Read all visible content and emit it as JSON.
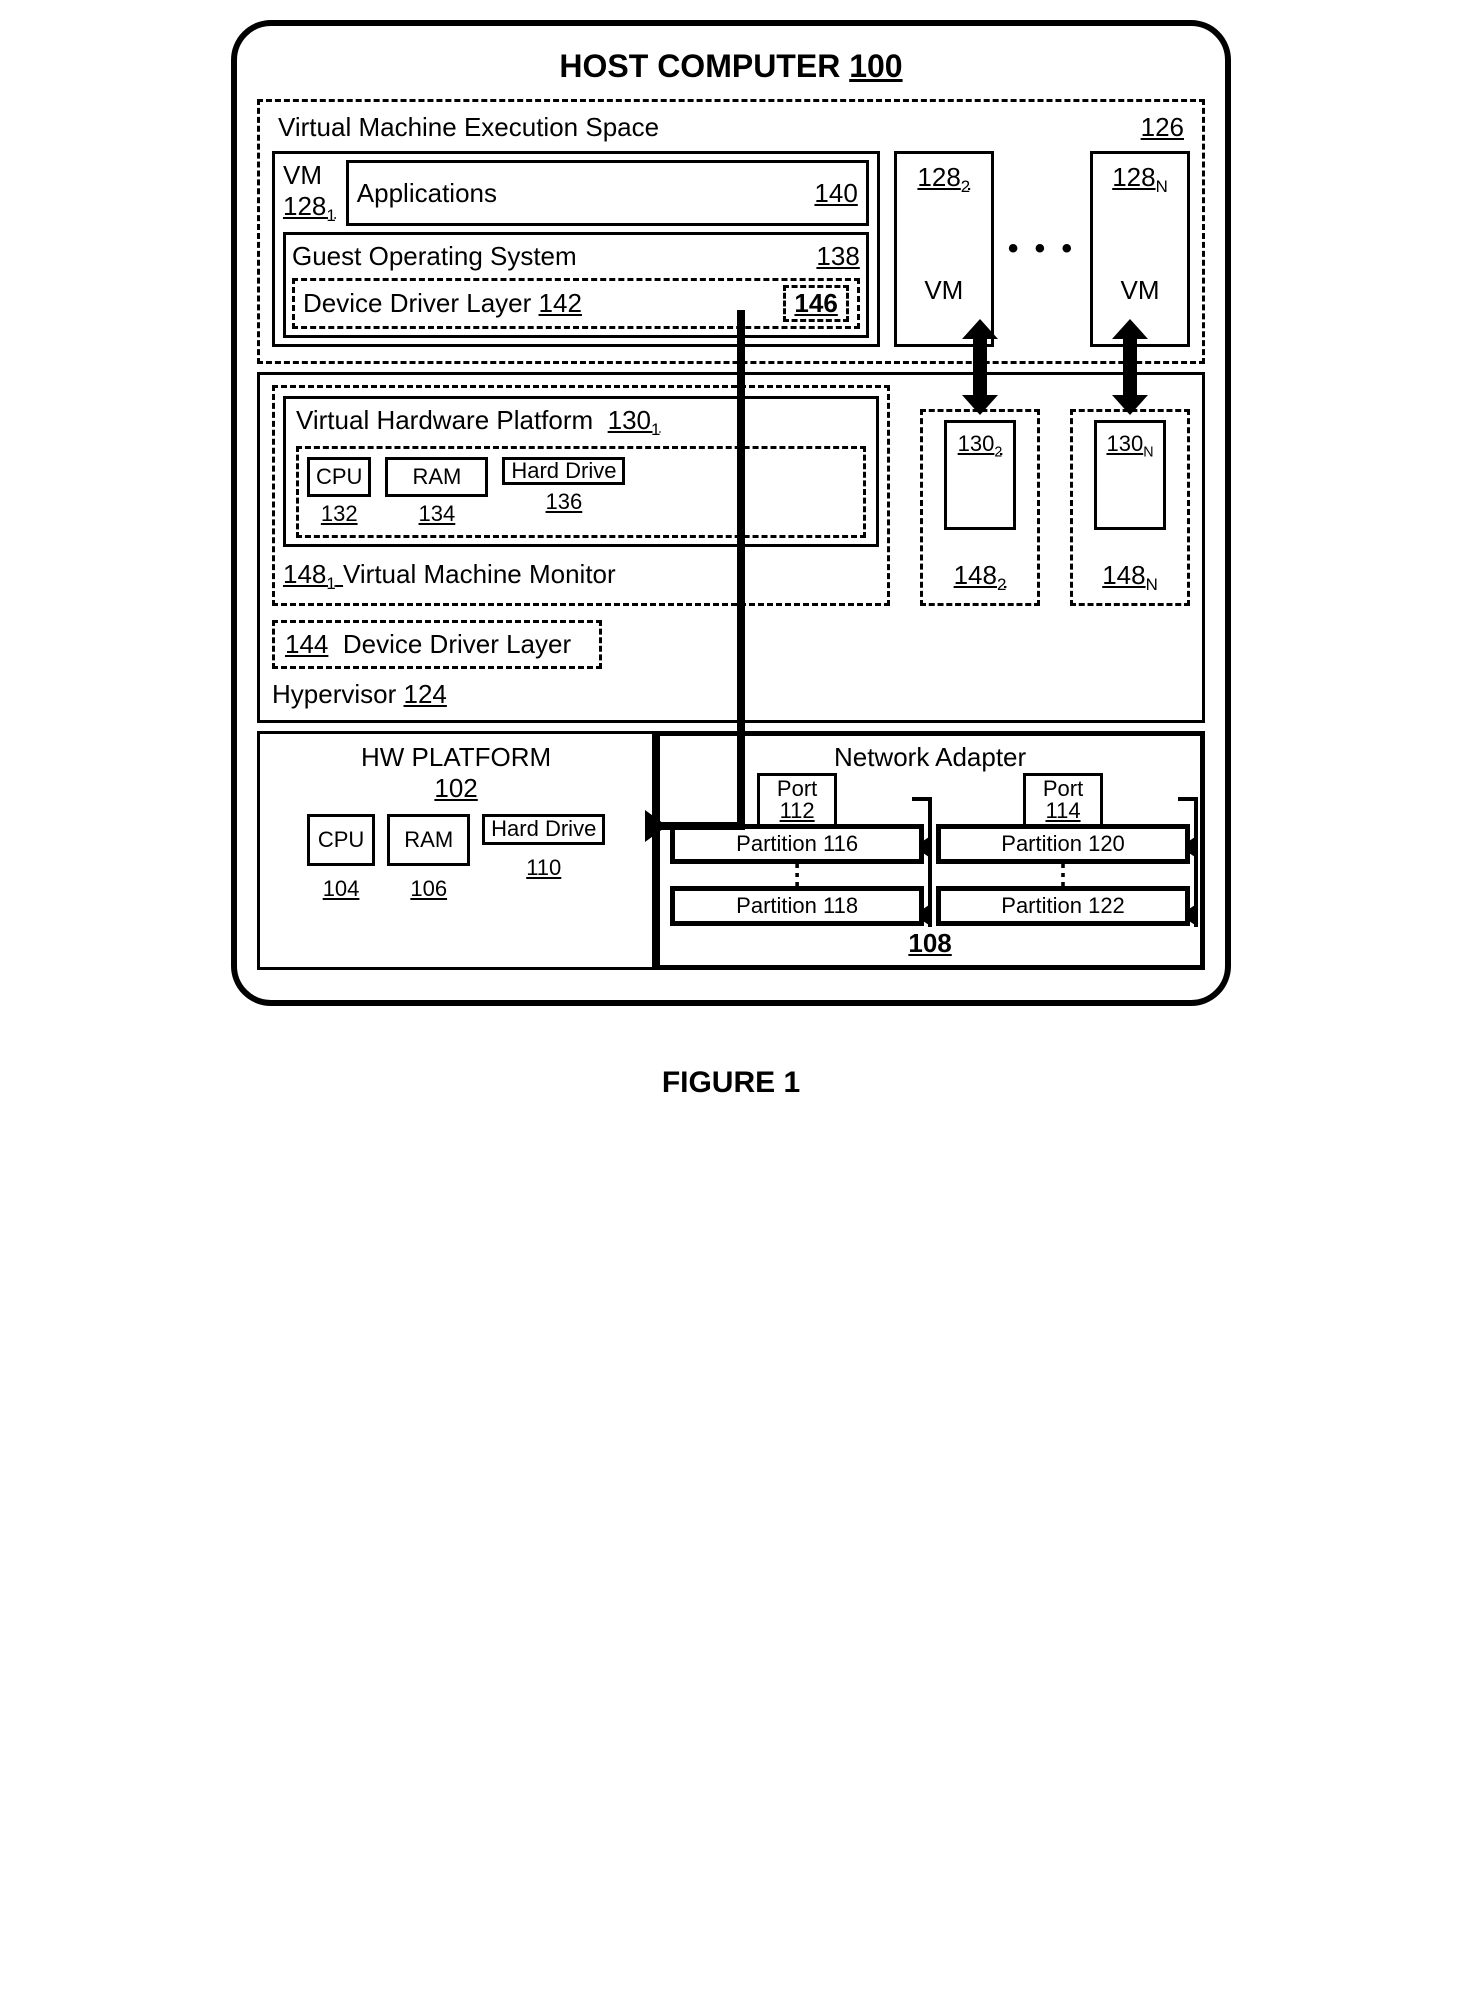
{
  "title": {
    "text": "HOST COMPUTER",
    "ref": "100"
  },
  "figure_caption": "FIGURE 1",
  "exec_space": {
    "label": "Virtual Machine Execution Space",
    "ref": "126",
    "vm1": {
      "label": "VM",
      "ref": "128",
      "sub": "1",
      "apps_label": "Applications",
      "apps_ref": "140",
      "gos_label": "Guest Operating System",
      "gos_ref": "138",
      "ddl_label": "Device Driver Layer",
      "ddl_ref": "142",
      "ddl_item_ref": "146"
    },
    "vm2": {
      "ref": "128",
      "sub": "2",
      "label": "VM"
    },
    "vmN": {
      "ref": "128",
      "sub": "N",
      "label": "VM"
    }
  },
  "hypervisor": {
    "label": "Hypervisor",
    "ref": "124",
    "ddl_label": "Device Driver Layer",
    "ddl_ref": "144",
    "vmm1": {
      "ref": "148",
      "sub": "1",
      "label": "Virtual Machine Monitor",
      "vhp_label": "Virtual Hardware Platform",
      "vhp_ref": "130",
      "vhp_sub": "1",
      "cpu": "CPU",
      "cpu_ref": "132",
      "ram": "RAM",
      "ram_ref": "134",
      "hd": "Hard Drive",
      "hd_ref": "136"
    },
    "vmm2": {
      "ref": "148",
      "sub": "2",
      "vhp_ref": "130",
      "vhp_sub": "2"
    },
    "vmmN": {
      "ref": "148",
      "sub": "N",
      "vhp_ref": "130",
      "vhp_sub": "N"
    }
  },
  "hw": {
    "label": "HW PLATFORM",
    "ref": "102",
    "cpu": "CPU",
    "cpu_ref": "104",
    "ram": "RAM",
    "ram_ref": "106",
    "hd": "Hard Drive",
    "hd_ref": "110",
    "net": {
      "label": "Network Adapter",
      "ref": "108",
      "port1": "Port",
      "port1_ref": "112",
      "port2": "Port",
      "port2_ref": "114",
      "p116": "Partition 116",
      "p118": "Partition 118",
      "p120": "Partition 120",
      "p122": "Partition 122"
    }
  }
}
